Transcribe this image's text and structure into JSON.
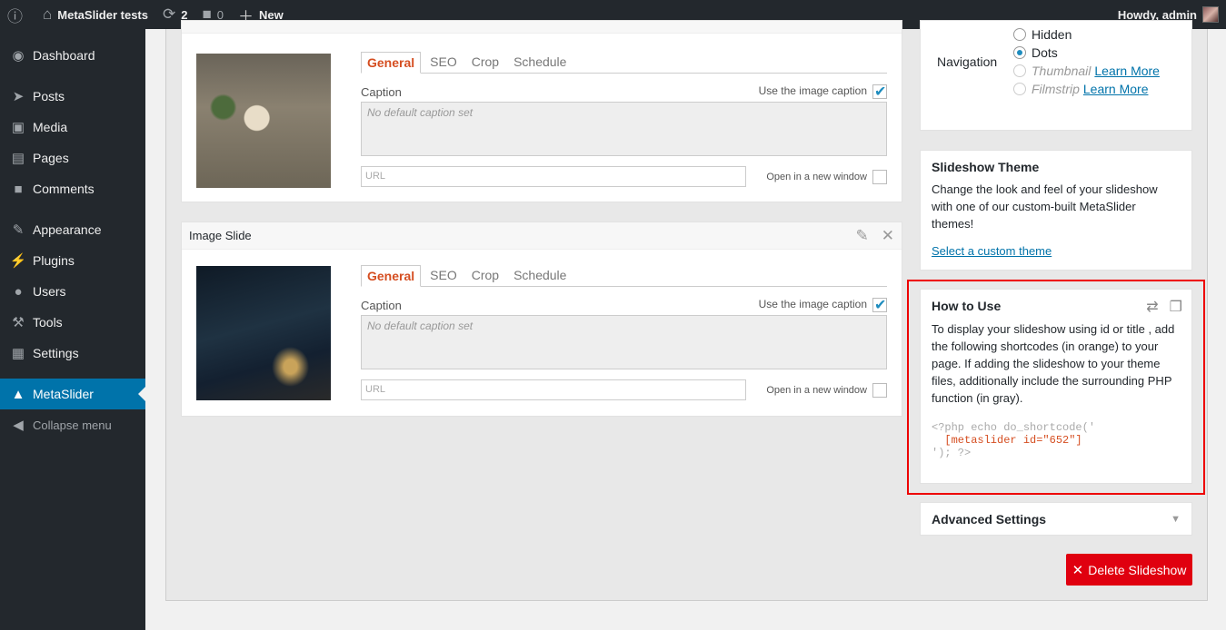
{
  "adminbar": {
    "site_name": "MetaSlider tests",
    "updates_count": "2",
    "comments_count": "0",
    "new_label": "New",
    "greeting": "Howdy, admin"
  },
  "sidebar": {
    "items": [
      {
        "label": "Dashboard",
        "icon": "dashboard-icon"
      },
      {
        "label": "Posts",
        "icon": "pin-icon"
      },
      {
        "label": "Media",
        "icon": "media-icon"
      },
      {
        "label": "Pages",
        "icon": "pages-icon"
      },
      {
        "label": "Comments",
        "icon": "comment-icon"
      },
      {
        "label": "Appearance",
        "icon": "brush-icon"
      },
      {
        "label": "Plugins",
        "icon": "plug-icon"
      },
      {
        "label": "Users",
        "icon": "user-icon"
      },
      {
        "label": "Tools",
        "icon": "wrench-icon"
      },
      {
        "label": "Settings",
        "icon": "settings-icon"
      },
      {
        "label": "MetaSlider",
        "icon": "metaslider-icon"
      },
      {
        "label": "Collapse menu",
        "icon": "collapse-icon"
      }
    ]
  },
  "slides": [
    {
      "title": "",
      "tabs": [
        "General",
        "SEO",
        "Crop",
        "Schedule"
      ],
      "caption_label": "Caption",
      "use_image_caption": "Use the image caption",
      "caption_placeholder": "No default caption set",
      "url_placeholder": "URL",
      "new_window_label": "Open in a new window"
    },
    {
      "title": "Image Slide",
      "tabs": [
        "General",
        "SEO",
        "Crop",
        "Schedule"
      ],
      "caption_label": "Caption",
      "use_image_caption": "Use the image caption",
      "caption_placeholder": "No default caption set",
      "url_placeholder": "URL",
      "new_window_label": "Open in a new window"
    }
  ],
  "navigation": {
    "label": "Navigation",
    "options": [
      {
        "label": "Hidden"
      },
      {
        "label": "Dots",
        "selected": true
      },
      {
        "label": "Thumbnail",
        "link": "Learn More"
      },
      {
        "label": "Filmstrip",
        "link": "Learn More"
      }
    ]
  },
  "theme_box": {
    "title": "Slideshow Theme",
    "description": "Change the look and feel of your slideshow with one of our custom-built MetaSlider themes!",
    "link": "Select a custom theme"
  },
  "howto_box": {
    "title": "How to Use",
    "description": "To display your slideshow using id or title , add the following shortcodes (in orange) to your page. If adding the slideshow to your theme files, additionally include the surrounding PHP function (in gray).",
    "code_line1": "<?php echo do_shortcode('",
    "code_line2": "  [metaslider id=\"652\"]",
    "code_line3": "'); ?>"
  },
  "advanced_box": {
    "title": "Advanced Settings"
  },
  "delete_button": "Delete Slideshow",
  "colors": {
    "accent": "#0073aa",
    "delete": "#e0000f",
    "tab_active": "#d54e21",
    "highlight": "#ee0000"
  }
}
